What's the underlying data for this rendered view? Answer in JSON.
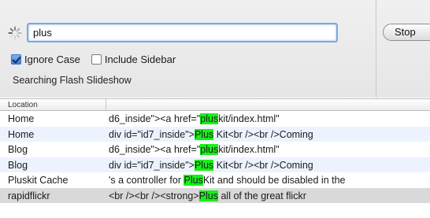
{
  "search": {
    "query": "plus"
  },
  "stop_button": {
    "label": "Stop"
  },
  "options": {
    "ignore_case": {
      "label": "Ignore Case",
      "checked": true
    },
    "include_sidebar": {
      "label": "Include Sidebar",
      "checked": false
    }
  },
  "status": "Searching Flash Slideshow",
  "table": {
    "header": {
      "location": "Location",
      "snippet": ""
    },
    "rows": [
      {
        "location": "Home",
        "pre": "d6_inside\"><a href=\"",
        "match": "plus",
        "post": "kit/index.html\""
      },
      {
        "location": "Home",
        "pre": "div id=\"id7_inside\">",
        "match": "Plus",
        "post": " Kit<br /><br />Coming"
      },
      {
        "location": "Blog",
        "pre": "d6_inside\"><a href=\"",
        "match": "plus",
        "post": "kit/index.html\""
      },
      {
        "location": "Blog",
        "pre": "div id=\"id7_inside\">",
        "match": "Plus",
        "post": " Kit<br /><br />Coming"
      },
      {
        "location": "Pluskit Cache",
        "pre": "'s a controller for ",
        "match": "Plus",
        "post": "Kit and should be disabled in the"
      },
      {
        "location": "rapidflickr",
        "pre": "<br /><br /><strong>",
        "match": "Plus",
        "post": " all of the great flickr"
      }
    ]
  },
  "colors": {
    "highlight": "#19ee19",
    "alt_row": "#edf3fe",
    "selected_row": "#d9d9d9",
    "focus_ring": "#7ea7dd"
  }
}
